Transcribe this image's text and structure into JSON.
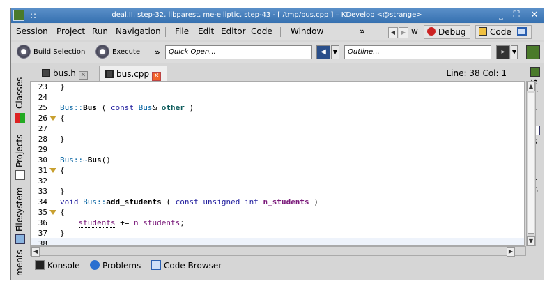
{
  "window": {
    "title": "deal.II, step-32, libparest, me-elliptic, step-43 - [ /tmp/bus.cpp ] – KDevelop <@strange>",
    "grip": "::",
    "btn_minimize": "⎵",
    "btn_maximize": "⛶",
    "btn_close": "✕"
  },
  "menubar": {
    "items": [
      "Session",
      "Project",
      "Run",
      "Navigation",
      "File",
      "Edit",
      "Editor",
      "Code",
      "Window"
    ],
    "overflow": "»",
    "area_partial": "w",
    "area_debug": "Debug",
    "area_code": "Code"
  },
  "toolbar": {
    "build_selection": "Build Selection",
    "execute": "Execute",
    "overflow": "»",
    "quick_open_placeholder": "Quick Open...",
    "outline_placeholder": "Outline..."
  },
  "tabs": [
    {
      "label": "bus.h",
      "active": false
    },
    {
      "label": "bus.cpp",
      "active": true
    }
  ],
  "status": {
    "position": "Line: 38 Col: 1"
  },
  "left_dock": [
    "Classes",
    "Projects",
    "Filesystem",
    "ments"
  ],
  "right_dock": [
    "Snippets",
    "Documentation"
  ],
  "bottom_dock": [
    "Konsole",
    "Problems",
    "Code Browser"
  ],
  "editor": {
    "current_line": "38",
    "lines": [
      {
        "n": "23",
        "fold": false,
        "text": "}"
      },
      {
        "n": "24",
        "fold": false,
        "text": ""
      },
      {
        "n": "25",
        "fold": false,
        "text": "Bus::Bus ( const Bus& other )"
      },
      {
        "n": "26",
        "fold": true,
        "text": "{"
      },
      {
        "n": "27",
        "fold": false,
        "text": ""
      },
      {
        "n": "28",
        "fold": false,
        "text": "}"
      },
      {
        "n": "29",
        "fold": false,
        "text": ""
      },
      {
        "n": "30",
        "fold": false,
        "text": "Bus::~Bus()"
      },
      {
        "n": "31",
        "fold": true,
        "text": "{"
      },
      {
        "n": "32",
        "fold": false,
        "text": ""
      },
      {
        "n": "33",
        "fold": false,
        "text": "}"
      },
      {
        "n": "34",
        "fold": false,
        "text": "void Bus::add_students ( const unsigned int n_students )"
      },
      {
        "n": "35",
        "fold": true,
        "text": "{"
      },
      {
        "n": "36",
        "fold": false,
        "text": "    students += n_students;"
      },
      {
        "n": "37",
        "fold": false,
        "text": "}"
      },
      {
        "n": "38",
        "fold": false,
        "text": ""
      }
    ]
  },
  "colors": {
    "titlebar": "#3c78b8",
    "keyword": "#1f1c9d",
    "type": "#0a5a5a",
    "fold_marker": "#c8a030",
    "close_tab": "#f1642a"
  }
}
